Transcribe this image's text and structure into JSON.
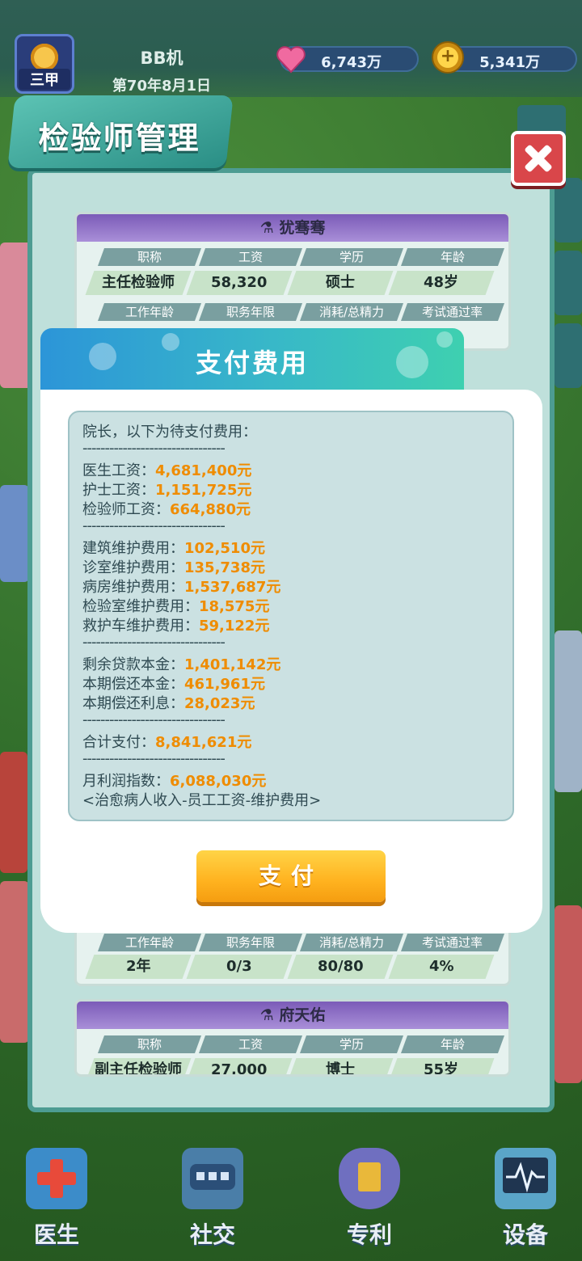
{
  "hud": {
    "level_badge": "三甲",
    "player_name": "BB机",
    "game_date": "第70年8月1日",
    "hearts": "6,743万",
    "coins": "5,341万",
    "heart_icon": "heart-icon",
    "coin_icon": "coin-icon"
  },
  "panel": {
    "title": "检验师管理",
    "close_icon": "close-icon",
    "cards": [
      {
        "name": "犹骞骞",
        "labels": [
          "职称",
          "工资",
          "学历",
          "年龄",
          "工作年龄",
          "职务年限",
          "消耗/总精力",
          "考试通过率"
        ],
        "title": "主任检验师",
        "salary": "58,320",
        "education": "硕士",
        "age": "48岁"
      },
      {
        "name": "",
        "labels": [
          "工作年龄",
          "职务年限",
          "消耗/总精力",
          "考试通过率"
        ],
        "work_years": "2年",
        "duty_years": "0/3",
        "energy": "80/80",
        "pass_rate": "4%"
      },
      {
        "name": "府天佑",
        "labels": [
          "职称",
          "工资",
          "学历",
          "年龄"
        ],
        "title": "副主任检验师",
        "salary": "27,000",
        "education": "博士",
        "age": "55岁"
      }
    ]
  },
  "dialog": {
    "title": "支付费用",
    "intro": "院长，以下为待支付费用：",
    "separator": "--------------------------------",
    "lines": [
      {
        "label": "医生工资：",
        "amount": "4,681,400元"
      },
      {
        "label": "护士工资：",
        "amount": "1,151,725元"
      },
      {
        "label": "检验师工资：",
        "amount": "664,880元"
      },
      {
        "label": "建筑维护费用：",
        "amount": "102,510元"
      },
      {
        "label": "诊室维护费用：",
        "amount": "135,738元"
      },
      {
        "label": "病房维护费用：",
        "amount": "1,537,687元"
      },
      {
        "label": "检验室维护费用：",
        "amount": "18,575元"
      },
      {
        "label": "救护车维护费用：",
        "amount": "59,122元"
      },
      {
        "label": "剩余贷款本金：",
        "amount": "1,401,142元"
      },
      {
        "label": "本期偿还本金：",
        "amount": "461,961元"
      },
      {
        "label": "本期偿还利息：",
        "amount": "28,023元"
      },
      {
        "label": "合计支付：",
        "amount": "8,841,621元"
      },
      {
        "label": "月利润指数：",
        "amount": "6,088,030元"
      }
    ],
    "formula": "<治愈病人收入-员工工资-维护费用>",
    "pay_label": "支付"
  },
  "nav": {
    "items": [
      {
        "label": "医生",
        "icon": "medical-cross-icon"
      },
      {
        "label": "社交",
        "icon": "chat-bubble-icon"
      },
      {
        "label": "专利",
        "icon": "shield-tower-icon"
      },
      {
        "label": "设备",
        "icon": "monitor-icon"
      }
    ]
  },
  "colors": {
    "amount": "#ef8c00",
    "header_gradient_start": "#2c95d8",
    "header_gradient_end": "#3ed0b0",
    "pay_button": "#ffb21f"
  }
}
